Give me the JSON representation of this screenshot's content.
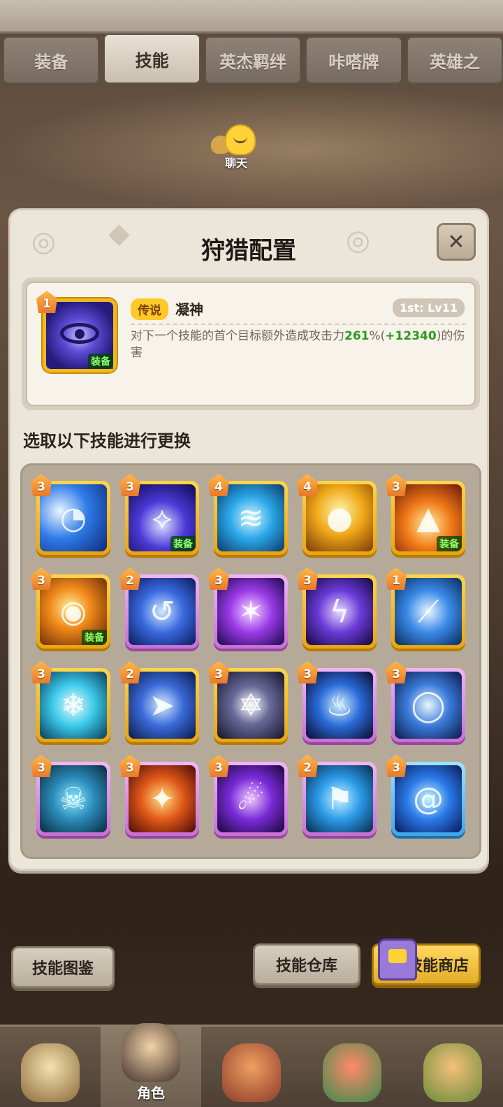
{
  "tabs": [
    {
      "label": "装备",
      "active": false
    },
    {
      "label": "技能",
      "active": true
    },
    {
      "label": "英杰羁绊",
      "active": false
    },
    {
      "label": "咔嗒牌",
      "active": false
    },
    {
      "label": "英雄之",
      "active": false
    }
  ],
  "chat": {
    "label": "聊天"
  },
  "panel": {
    "title": "狩猎配置",
    "close_icon": "close-icon",
    "current_skill": {
      "level": "1",
      "rarity": "传说",
      "name": "凝神",
      "rank": "1st: Lv11",
      "equip_tag": "装备",
      "desc_prefix": "对下一个技能的首个目标额外造成攻击力",
      "desc_pct": "261",
      "desc_unit": "%(",
      "desc_bonus": "+12340",
      "desc_suffix": ")的伤害"
    },
    "subtitle": "选取以下技能进行更换",
    "skills": [
      {
        "level": "3",
        "frame": "gold",
        "equipped": false,
        "icon": "blue-vortex-slash-icon"
      },
      {
        "level": "3",
        "frame": "gold",
        "equipped": true,
        "icon": "blue-spike-burst-icon"
      },
      {
        "level": "4",
        "frame": "gold",
        "equipped": false,
        "icon": "whirlwind-icon"
      },
      {
        "level": "4",
        "frame": "gold",
        "equipped": false,
        "icon": "golden-orb-icon"
      },
      {
        "level": "3",
        "frame": "gold",
        "equipped": true,
        "icon": "fire-pillar-icon"
      },
      {
        "level": "3",
        "frame": "gold",
        "equipped": true,
        "icon": "fireball-icon"
      },
      {
        "level": "2",
        "frame": "purple",
        "equipped": false,
        "icon": "rune-swirl-icon"
      },
      {
        "level": "3",
        "frame": "purple",
        "equipped": false,
        "icon": "purple-lightning-icon"
      },
      {
        "level": "3",
        "frame": "gold",
        "equipped": false,
        "icon": "lightning-strike-icon"
      },
      {
        "level": "1",
        "frame": "gold",
        "equipped": false,
        "icon": "ice-shards-icon"
      },
      {
        "level": "3",
        "frame": "gold",
        "equipped": false,
        "icon": "snowflake-icon"
      },
      {
        "level": "2",
        "frame": "gold",
        "equipped": false,
        "icon": "ice-spear-icon"
      },
      {
        "level": "3",
        "frame": "gold",
        "equipped": false,
        "icon": "hexagram-icon"
      },
      {
        "level": "3",
        "frame": "purple",
        "equipped": false,
        "icon": "blue-flame-icon"
      },
      {
        "level": "3",
        "frame": "purple",
        "equipped": false,
        "icon": "ring-slash-icon"
      },
      {
        "level": "3",
        "frame": "purple",
        "equipped": false,
        "icon": "skull-cube-icon"
      },
      {
        "level": "3",
        "frame": "purple",
        "equipped": false,
        "icon": "fire-puppet-icon"
      },
      {
        "level": "3",
        "frame": "purple",
        "equipped": false,
        "icon": "violet-comet-icon"
      },
      {
        "level": "2",
        "frame": "purple",
        "equipped": false,
        "icon": "twin-totems-icon"
      },
      {
        "level": "3",
        "frame": "blue",
        "equipped": false,
        "icon": "water-vortex-icon"
      }
    ]
  },
  "buttons": {
    "codex": "技能图鉴",
    "storage": "技能仓库",
    "shop": "技能商店"
  },
  "nav": {
    "items": [
      {
        "label": "",
        "active": false
      },
      {
        "label": "角色",
        "active": true
      },
      {
        "label": "",
        "active": false
      },
      {
        "label": "",
        "active": false
      },
      {
        "label": "",
        "active": false
      }
    ]
  }
}
